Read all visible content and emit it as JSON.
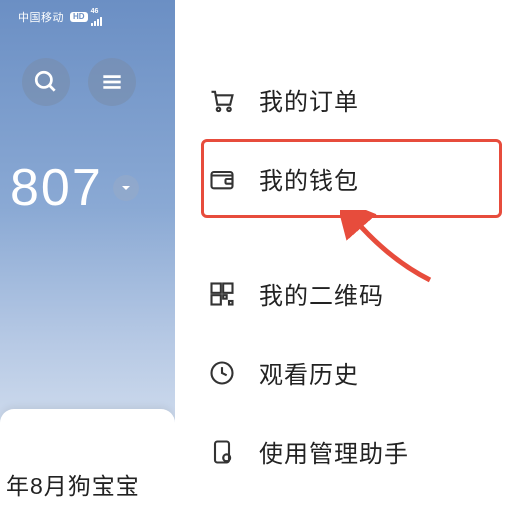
{
  "statusBar": {
    "carrier": "中国移动",
    "networkBadge": "HD",
    "signalLabel": "46"
  },
  "leftPanel": {
    "number": "807",
    "cardText": "年8月狗宝宝"
  },
  "menu": {
    "orders": "我的订单",
    "wallet": "我的钱包",
    "qrcode": "我的二维码",
    "history": "观看历史",
    "assistant": "使用管理助手"
  }
}
